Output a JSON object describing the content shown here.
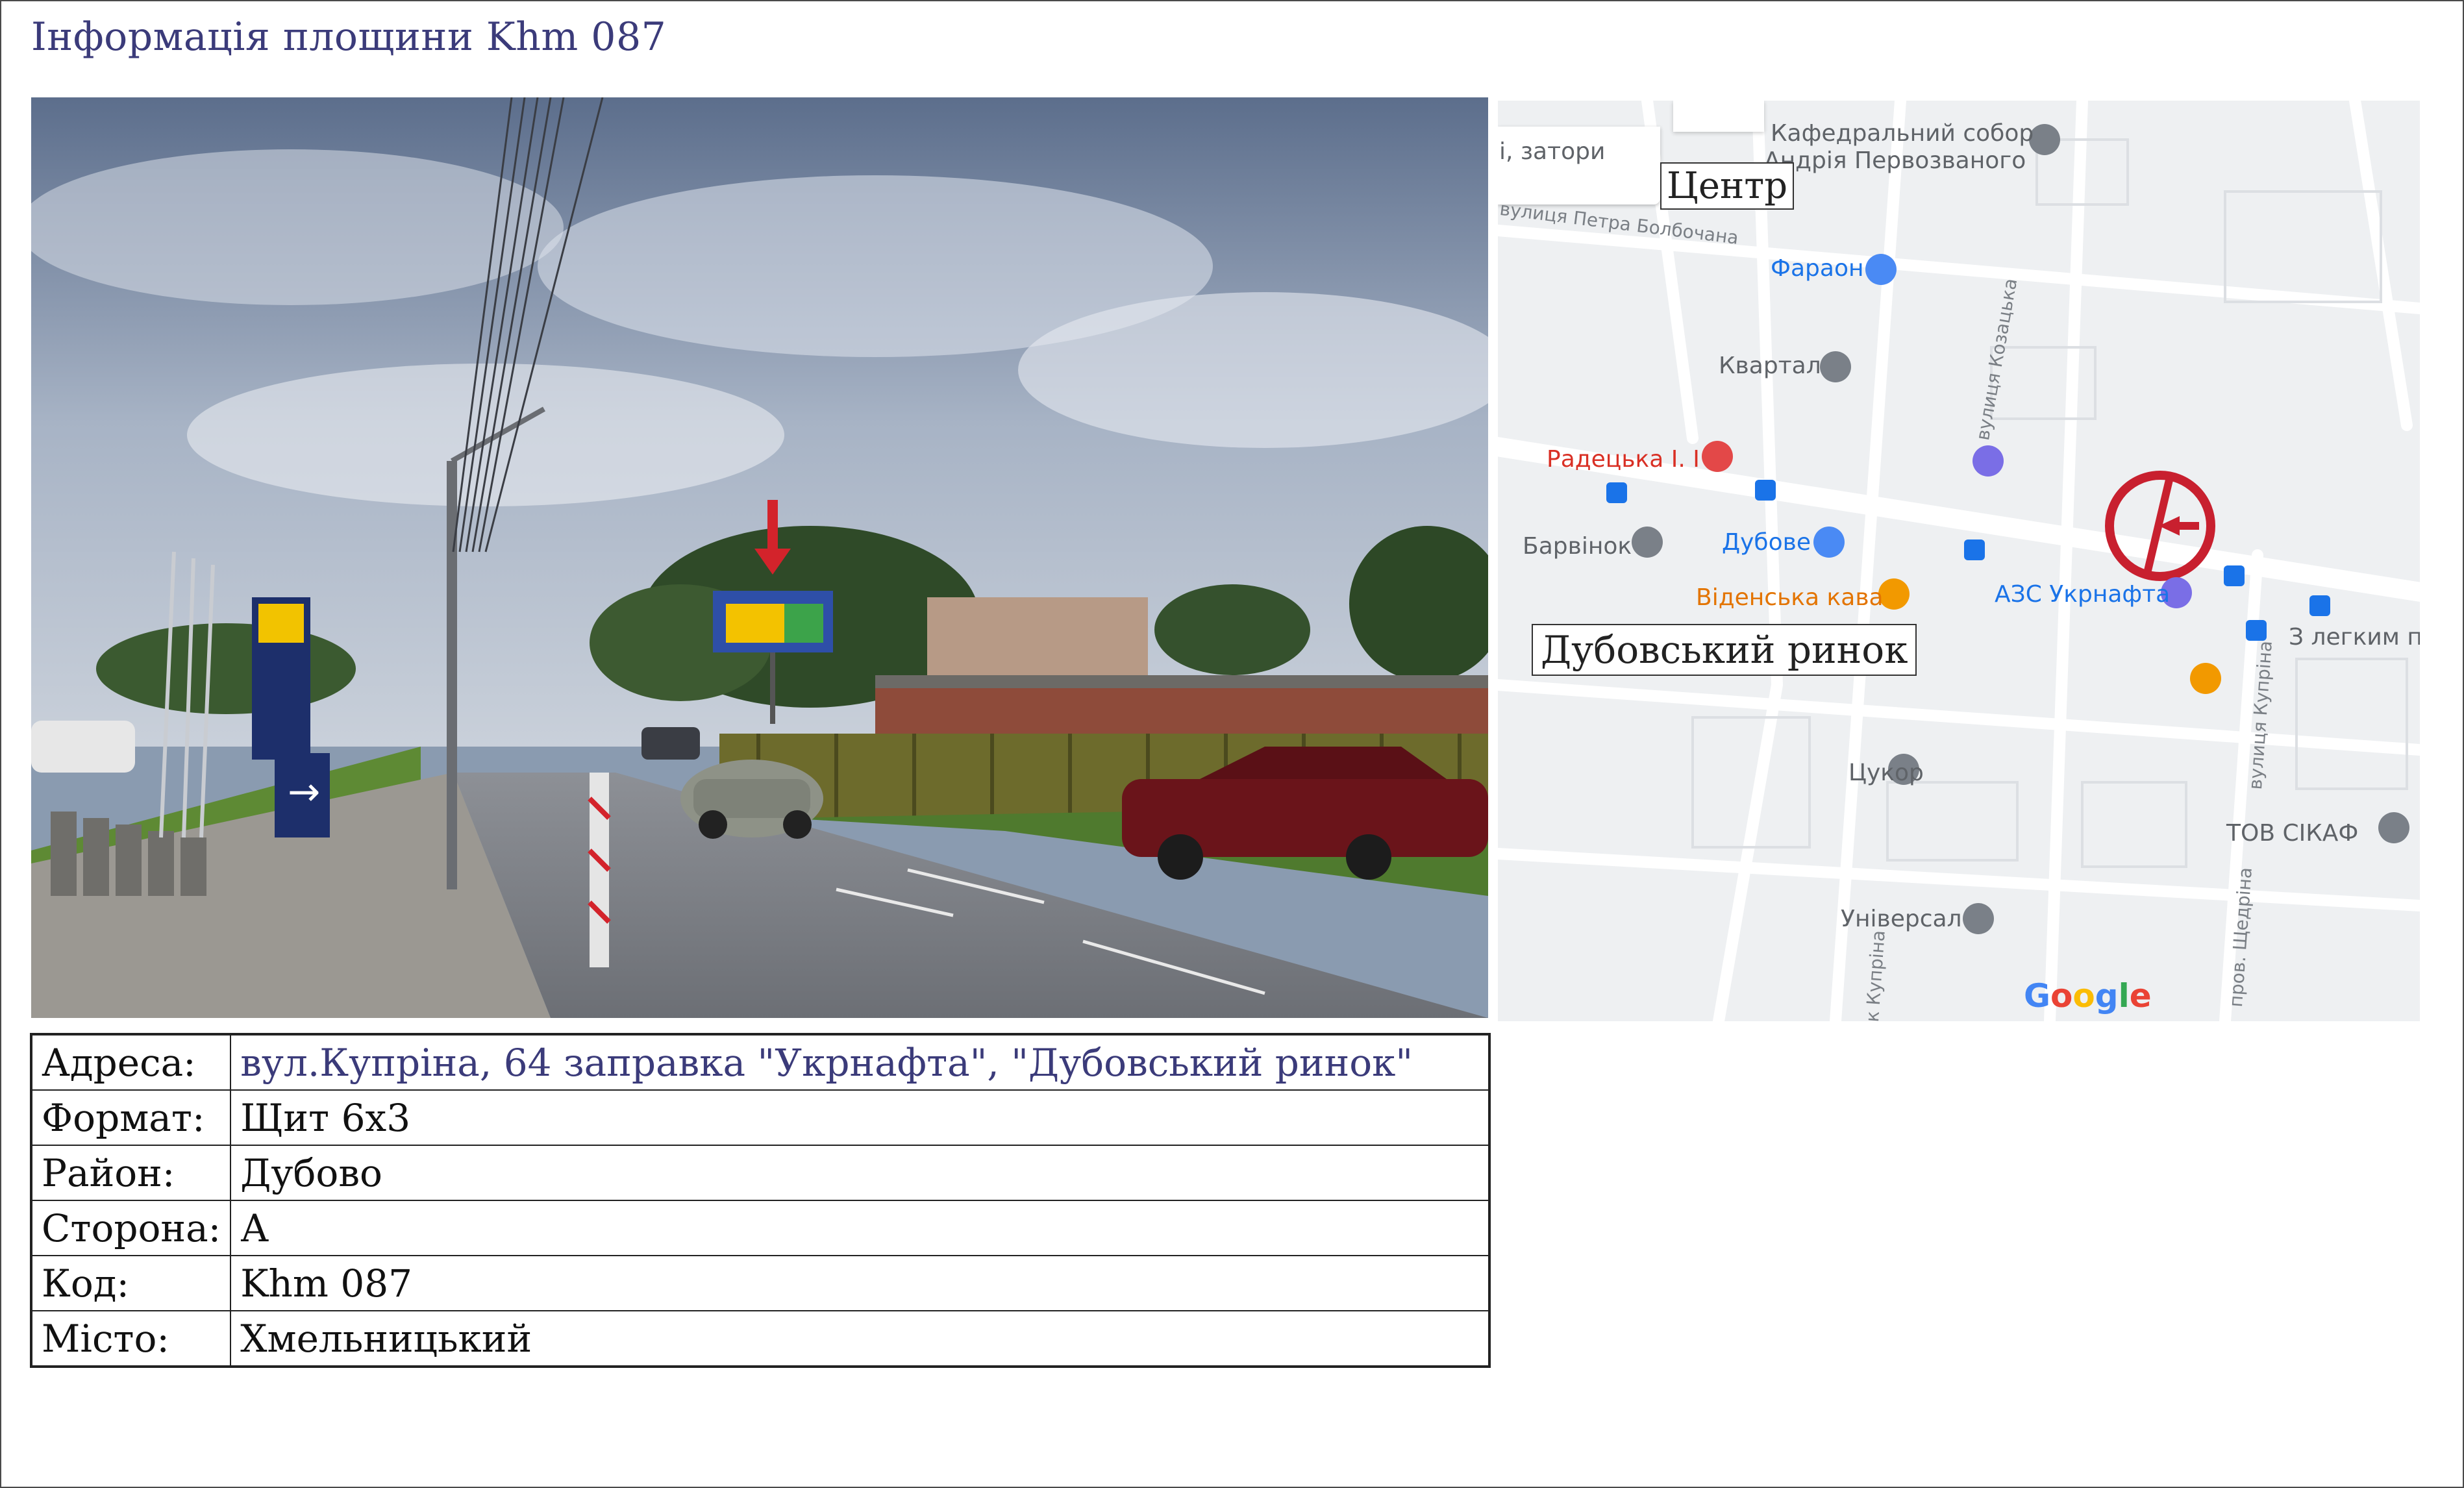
{
  "page": {
    "title": "Інформація площини Khm 087"
  },
  "map": {
    "traffic_label": "і, затори",
    "places": [
      {
        "name": "Кафедральний собор",
        "color": "gray"
      },
      {
        "name": "Андрія Первозваного",
        "color": "gray"
      },
      {
        "name": "Фараон",
        "color": "blue"
      },
      {
        "name": "Квартал",
        "color": "gray"
      },
      {
        "name": "Радецька І. І",
        "color": "red"
      },
      {
        "name": "Барвінок",
        "color": "gray"
      },
      {
        "name": "Дубове",
        "color": "blue"
      },
      {
        "name": "Віденська кава",
        "color": "orange"
      },
      {
        "name": "АЗС Укрнафта",
        "color": "blue"
      },
      {
        "name": "З легким па",
        "color": "gray"
      },
      {
        "name": "Цукор",
        "color": "gray"
      },
      {
        "name": "ТОВ СІКАФ",
        "color": "gray"
      },
      {
        "name": "Універсал",
        "color": "gray"
      }
    ],
    "streets": [
      "вулиця Петра Болбочана",
      "вулиця Козацька",
      "вулиця Купріна",
      "пров. Щедріна",
      "к Купріна"
    ],
    "box_labels": {
      "center": "Центр",
      "market": "Дубовський ринок"
    },
    "brand": "Google",
    "brand_colors": [
      "#4285F4",
      "#EA4335",
      "#FBBC05",
      "#4285F4",
      "#34A853",
      "#EA4335"
    ],
    "marker_color": "#c8202f"
  },
  "info": {
    "rows": [
      {
        "key": "Адреса:",
        "value": "вул.Купріна, 64 заправка \"Укрнафта\",  \"Дубовський ринок\""
      },
      {
        "key": "Формат:",
        "value": "Щит 6х3"
      },
      {
        "key": "Район:",
        "value": "Дубово"
      },
      {
        "key": "Сторона:",
        "value": "А"
      },
      {
        "key": "Код:",
        "value": "Khm 087"
      },
      {
        "key": "Місто:",
        "value": "Хмельницький"
      }
    ]
  },
  "colors": {
    "title": "#3b3b7a",
    "arrow": "#d3232b"
  }
}
